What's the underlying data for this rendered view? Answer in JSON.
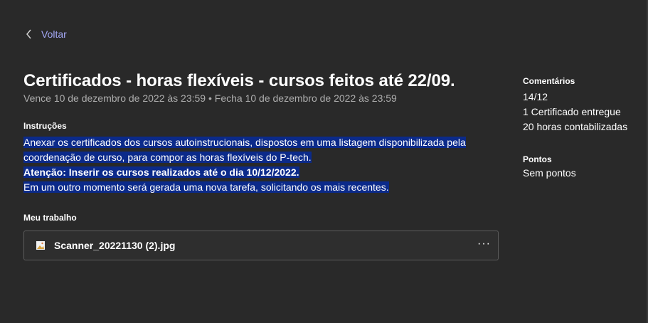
{
  "nav": {
    "back_label": "Voltar"
  },
  "assignment": {
    "title": "Certificados - horas flexíveis - cursos feitos até 22/09.",
    "due_line": "Vence 10 de dezembro de 2022 às 23:59 • Fecha 10 de dezembro de 2022 às 23:59"
  },
  "instructions": {
    "label": "Instruções",
    "line1": "Anexar os certificados dos cursos autoinstrucionais, dispostos em uma listagem disponibilizada pela",
    "line2": "coordenação de curso, para compor as horas flexíveis do P-tech.",
    "line3": "Atenção: Inserir os cursos realizados até o dia 10/12/2022.",
    "line4": "Em um outro momento será gerada uma nova tarefa, solicitando os mais recentes."
  },
  "my_work": {
    "label": "Meu trabalho",
    "file_name": "Scanner_20221130 (2).jpg",
    "more_label": "···"
  },
  "sidebar": {
    "comments_label": "Comentários",
    "comments_lines": [
      "14/12",
      "1 Certificado entregue",
      "20 horas contabilizadas"
    ],
    "points_label": "Pontos",
    "points_value": "Sem pontos"
  },
  "colors": {
    "background": "#292929",
    "accent": "#a4a8f5",
    "highlight": "#0b2a8a"
  },
  "icons": {
    "back": "chevron-left-icon",
    "file": "image-file-icon",
    "more": "more-options-icon"
  }
}
